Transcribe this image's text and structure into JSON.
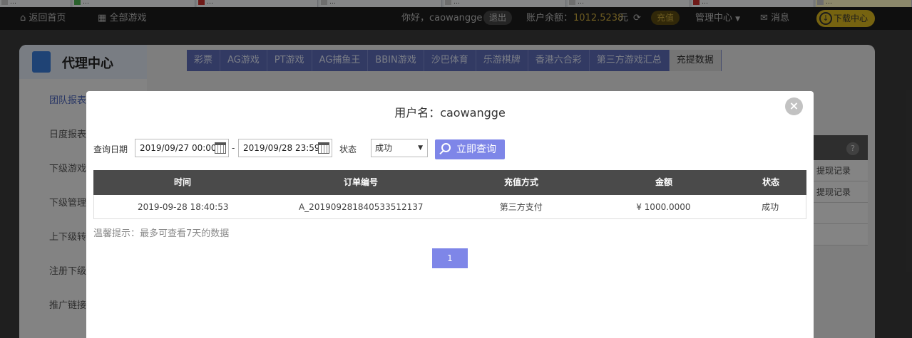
{
  "browser_tabs": [
    {
      "label": "…",
      "favicon": "page",
      "active": false
    },
    {
      "label": "…",
      "favicon": "green",
      "active": false
    },
    {
      "label": "…",
      "favicon": "red",
      "active": false
    },
    {
      "label": "…",
      "favicon": "page",
      "active": false
    },
    {
      "label": "…",
      "favicon": "page",
      "active": false
    },
    {
      "label": "…",
      "favicon": "page",
      "active": false
    },
    {
      "label": "…",
      "favicon": "red",
      "active": false
    },
    {
      "label": "…",
      "favicon": "page",
      "active": true
    }
  ],
  "topnav": {
    "home": "返回首页",
    "all_games": "全部游戏",
    "greeting": "你好，caowangge",
    "logout": "退出",
    "balance_label": "账户余额：",
    "balance_value": "1012.5238",
    "currency": "元",
    "recharge": "充值",
    "manage": "管理中心",
    "messages": "消息",
    "download": "下载中心"
  },
  "sidebar": {
    "title": "代理中心",
    "items": [
      "团队报表",
      "日度报表",
      "下级游戏",
      "下级管理",
      "上下级转",
      "注册下级",
      "推广链接"
    ]
  },
  "main_tabs": [
    "彩票",
    "AG游戏",
    "PT游戏",
    "AG捕鱼王",
    "BBIN游戏",
    "沙巴体育",
    "乐游棋牌",
    "香港六合彩",
    "第三方游戏汇总",
    "充提数据"
  ],
  "main_tabs_active": "充提数据",
  "bg_cells": [
    "提现记录",
    "提现记录"
  ],
  "modal": {
    "title": "用户名：caowangge",
    "close": "×",
    "query_date_label": "查询日期",
    "start_date": "2019/09/27 00:00",
    "date_separator": "-",
    "end_date": "2019/09/28 23:59",
    "status_label": "状态",
    "status_value": "成功",
    "query_button": "立即查询",
    "columns": [
      "时间",
      "订单编号",
      "充值方式",
      "金额",
      "状态"
    ],
    "rows": [
      [
        "2019-09-28 18:40:53",
        "A_201909281840533512137",
        "第三方支付",
        "¥ 1000.0000",
        "成功"
      ]
    ],
    "hint": "温馨提示：最多可查看7天的数据",
    "pages": [
      "1"
    ],
    "current_page": "1"
  },
  "colors": {
    "accent": "#7e86e8",
    "table_header": "#4a4a4a",
    "balance": "#c8a83c",
    "download": "#d8b41e"
  }
}
